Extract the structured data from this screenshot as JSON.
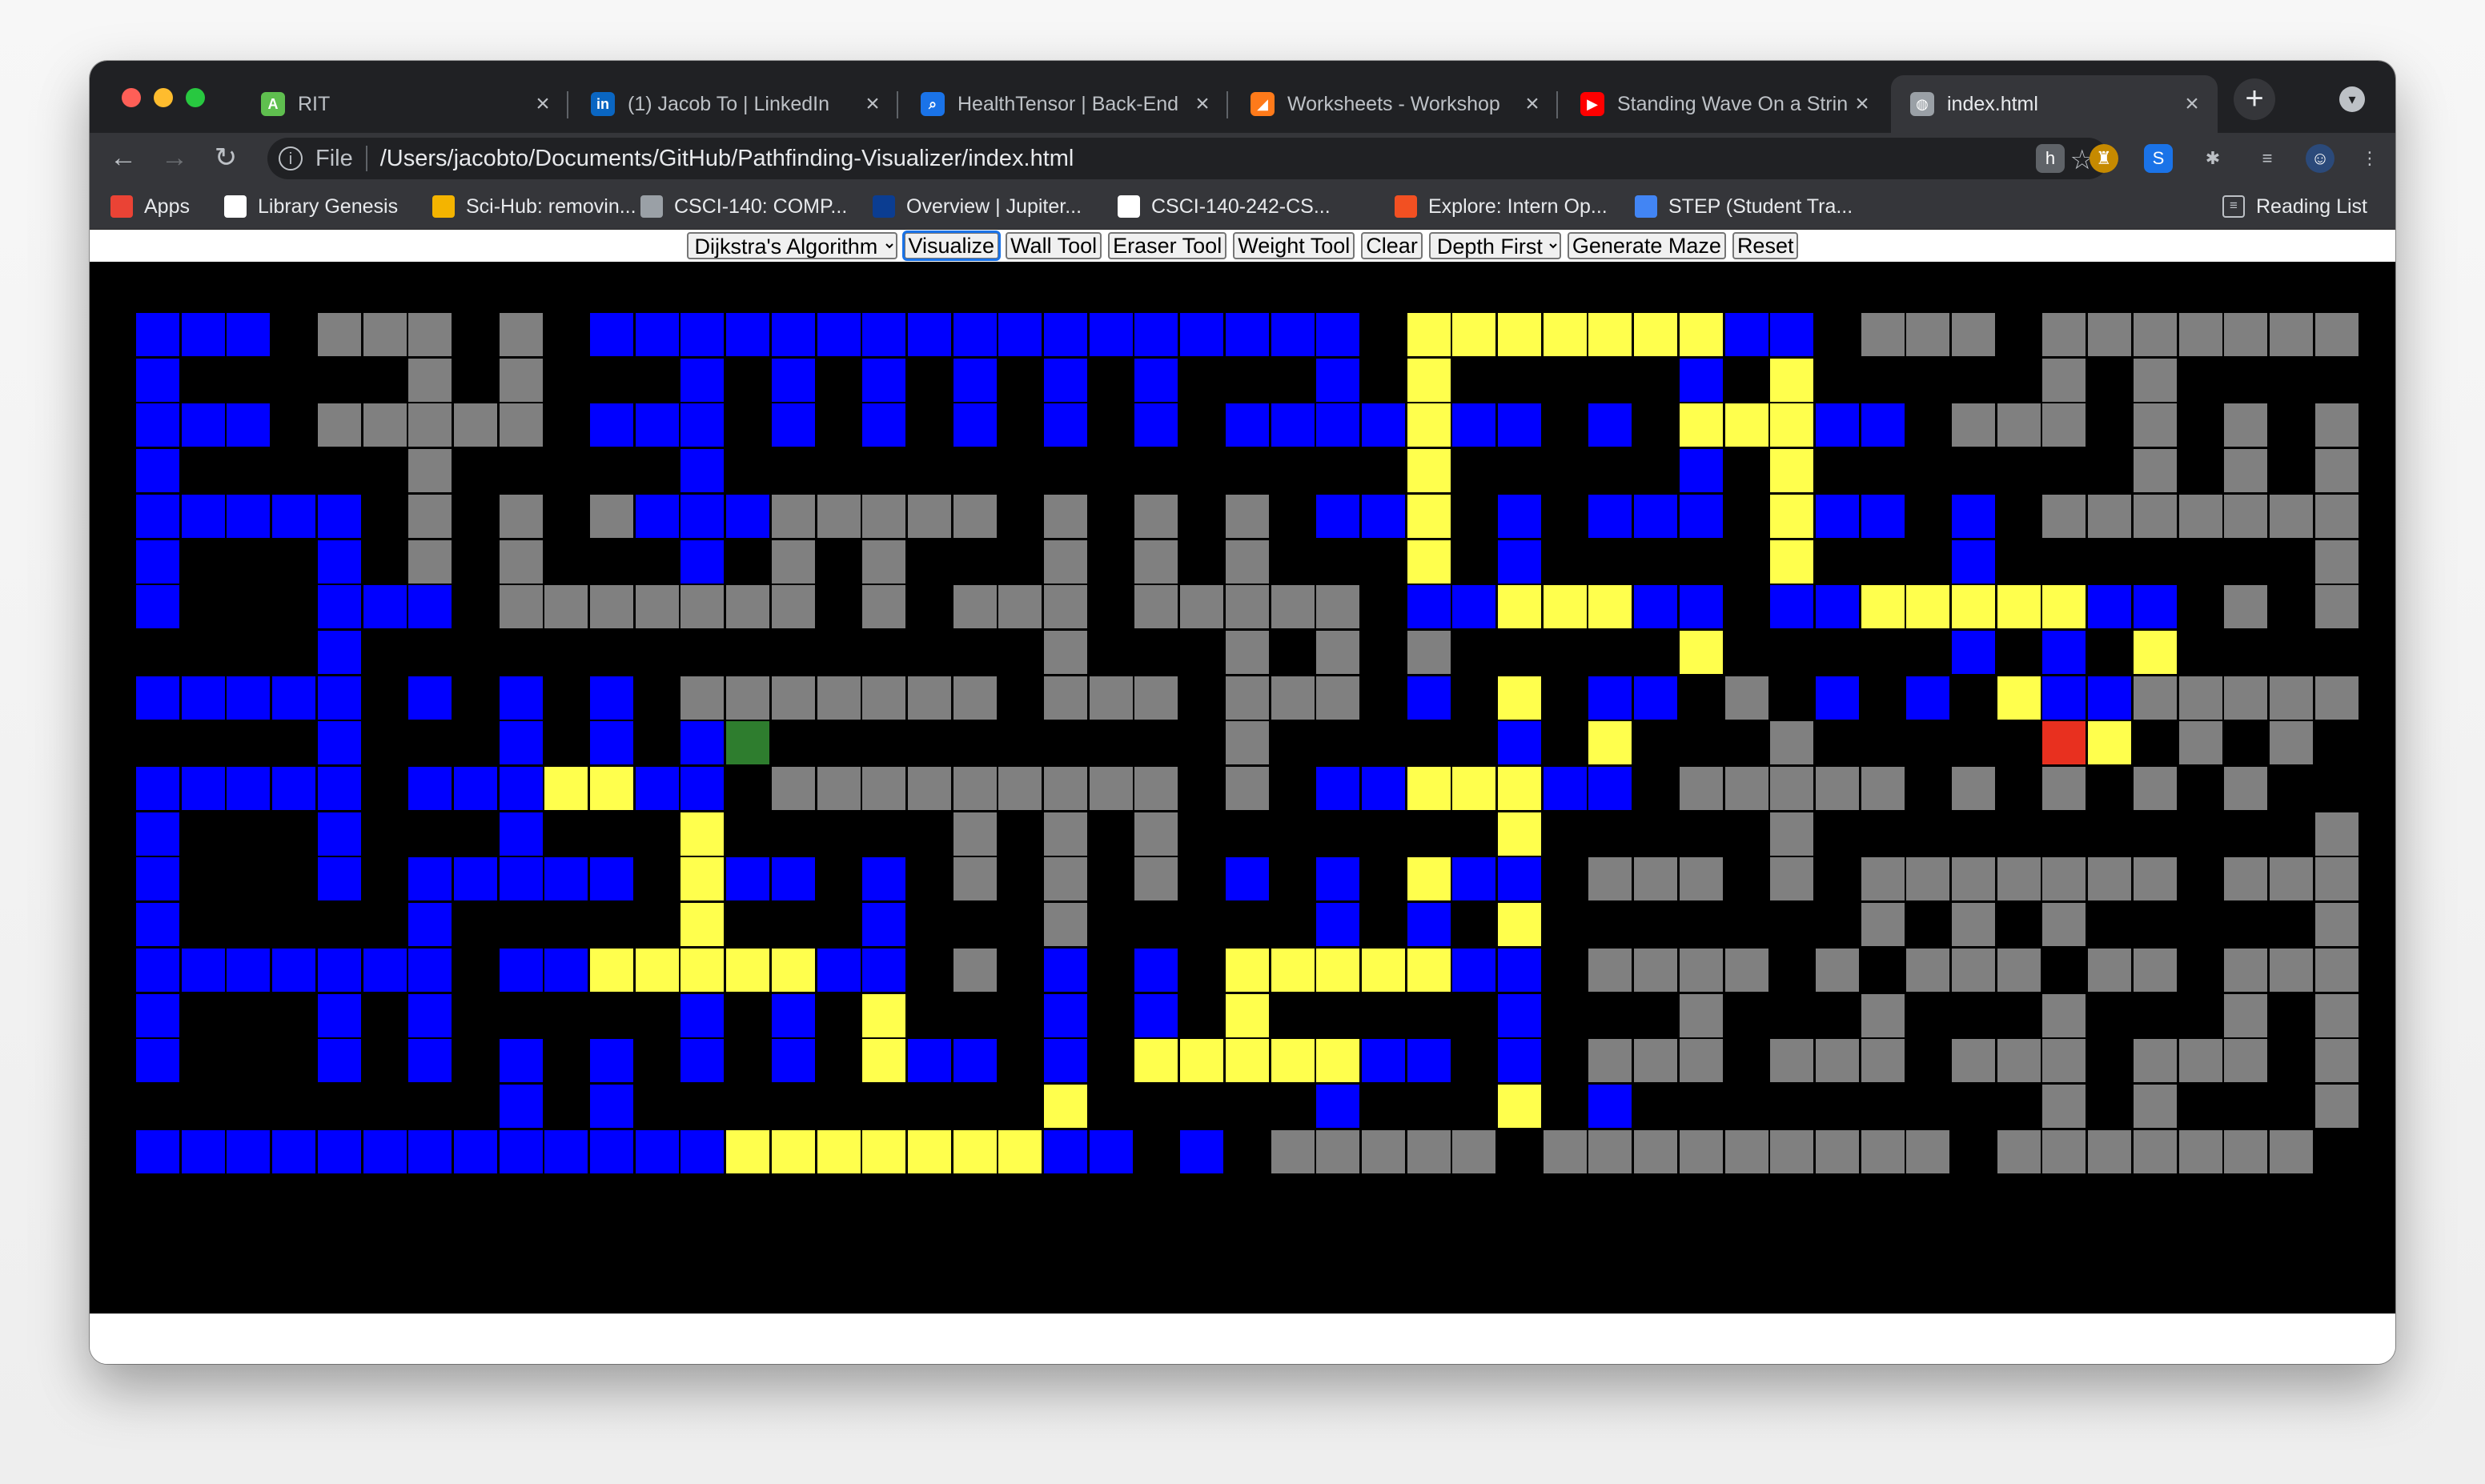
{
  "browser": {
    "tabs": [
      {
        "title": "RIT",
        "icon": "rit-icon",
        "color": "#5fbf4f",
        "glyph": "A"
      },
      {
        "title": "(1) Jacob To | LinkedIn",
        "icon": "linkedin-icon",
        "color": "#0a66c2",
        "glyph": "in"
      },
      {
        "title": "HealthTensor | Back-End",
        "icon": "healthtensor-icon",
        "color": "#1a73e8",
        "glyph": "⌕"
      },
      {
        "title": "Worksheets - Workshop",
        "icon": "worksheets-icon",
        "color": "#ff7a1a",
        "glyph": "◢"
      },
      {
        "title": "Standing Wave On a String",
        "icon": "youtube-icon",
        "color": "#ff0000",
        "glyph": "▶"
      },
      {
        "title": "index.html",
        "icon": "globe-icon",
        "color": "#9aa0a6",
        "glyph": "◍"
      }
    ],
    "address": {
      "scheme": "File",
      "path": "/Users/jacobto/Documents/GitHub/Pathfinding-Visualizer/index.html"
    },
    "bookmarks": [
      {
        "label": "Apps",
        "icon": "apps-grid-icon",
        "color": "#ea4335"
      },
      {
        "label": "Library Genesis",
        "icon": "library-genesis-icon",
        "color": "#ffffff"
      },
      {
        "label": "Sci-Hub: removin...",
        "icon": "scihub-icon",
        "color": "#f4b400"
      },
      {
        "label": "CSCI-140: COMP...",
        "icon": "globe-icon",
        "color": "#9aa0a6"
      },
      {
        "label": "Overview | Jupiter...",
        "icon": "nasa-icon",
        "color": "#0b3d91"
      },
      {
        "label": "CSCI-140-242-CS...",
        "icon": "github-icon",
        "color": "#ffffff"
      },
      {
        "label": "Explore: Intern Op...",
        "icon": "microsoft-icon",
        "color": "#f25022"
      },
      {
        "label": "STEP (Student Tra...",
        "icon": "google-icon",
        "color": "#4285f4"
      }
    ],
    "reading_list": "Reading List"
  },
  "controls": {
    "algorithm": "Dijkstra's Algorithm",
    "visualize": "Visualize",
    "wall_tool": "Wall Tool",
    "eraser_tool": "Eraser Tool",
    "weight_tool": "Weight Tool",
    "clear": "Clear",
    "maze_algorithm": "Depth First",
    "generate_maze": "Generate Maze",
    "reset": "Reset"
  },
  "grid": {
    "legend": {
      ".": "empty",
      "W": "wall",
      "V": "visited",
      "P": "path",
      "S": "start",
      "E": "end"
    },
    "colors": {
      "empty": "#000000",
      "wall": "#808080",
      "visited": "#0000ff",
      "path": "#ffff4d",
      "start": "#2e7d2e",
      "end": "#e8301f"
    },
    "rows": [
      "VVV.WWW.W.VVVVVVVVVVVVVVVVV.PPPPPPPVV.WWW.WWWWWWW",
      "V.....W.W...V.V.V.V.V.V...V.P.....V.P.....W.W....",
      "VVV.WWWWW.VVV.V.V.V.V.V.VVVVPVV.V.PPPVV.WWW.W.W.W",
      "V.....W.....V...............P.....V.P.......W.W.W",
      "VVVVV.W.W.WVVVWWWWW.W.W.W.VVP.V.VVV.PVV.V.WWWWWWW",
      "V...V.W.W...V.W.W...W.W.W...P.V.....P...V.......W",
      "V...VVV.WWWWWWW.W.WWW.WWWWW.VVPPPVV.VVPPPPPVV.W.W.W",
      "....V...............W...W.W.W.....P.....V.V.P.....W.W.W",
      "VVVVV.V.V.V.WWWWWWW.WWW.WWW.V.P.VV.W.V.V.PVVWWWWWW",
      "....V...V.V.VS..........W.....V.P...W.....EP.W.W.W.W",
      "VVVVV.VVVPPVV.WWWWWWWWW.W.VVPPPVV.WWWWW.W.W.W.W",
      "V...V...V...P.....W.W.W.......P.....W...........W",
      "V...V.VVVVV.PVV.V.W.W.W.V.V.PVV.WWW.W.WWWWWWW.WWW",
      "V.....V.....P...V...W.....V.V.P.......W.W.W.....W.W.W",
      "VVVVVVV.VVPPPPPVV.W.V.V.PPPPPVV.WWWW.W.WWW.WW.WWW",
      "V...V.V.....V.V.P...V.V.P.....V...W...W...W...W.W",
      "V...V.V.V.V.V.V.PVV.V.PPPPPVV.V.WWW.WWW.WWW.WWW.WWW",
      "........V.V.........P.....V...P.V.........W.W...W...W...W...W",
      "VVVVVVVVVVVVVPPPPPPPVV.V.WWWWW.WWWWWWWWW.WWWWWWW"
    ]
  }
}
